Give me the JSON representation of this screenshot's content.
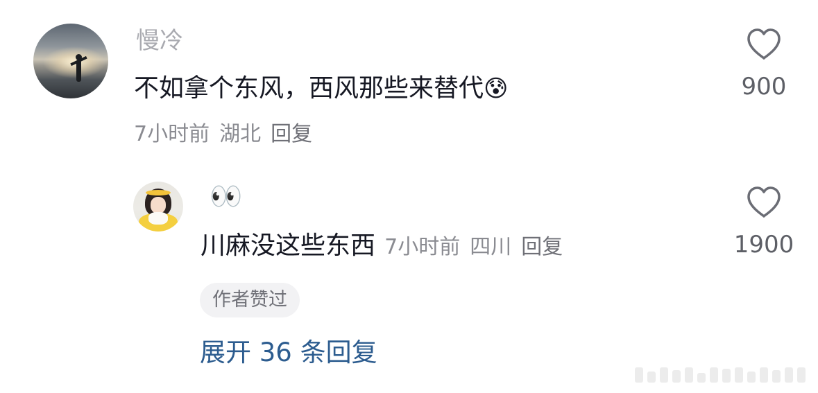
{
  "comment": {
    "username": "慢冷",
    "text": "不如拿个东风，西风那些来替代",
    "emoji": "😰",
    "time": "7小时前",
    "location": "湖北",
    "reply_label": "回复",
    "likes": "900"
  },
  "reply": {
    "emoji": "👀",
    "text": "川麻没这些东西",
    "time": "7小时前",
    "location": "四川",
    "reply_label": "回复",
    "likes": "1900",
    "badge": "作者赞过"
  },
  "expand_label": "展开 36 条回复",
  "icons": {
    "like": "heart-outline-icon"
  },
  "colors": {
    "link": "#2c5c8f",
    "text": "#161823",
    "muted": "#8a8b91"
  }
}
